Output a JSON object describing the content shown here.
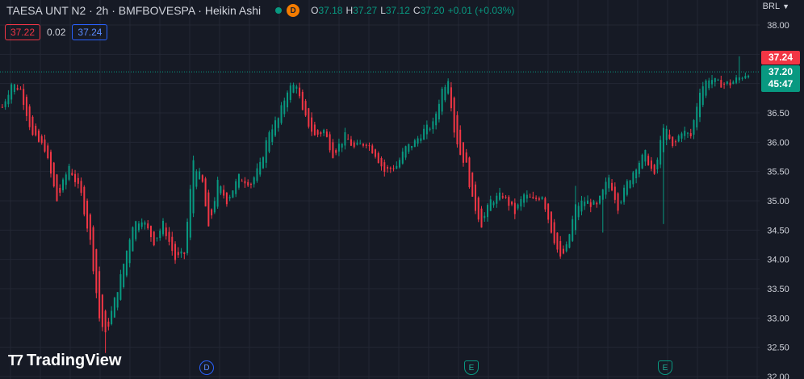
{
  "header": {
    "title": "TAESA UNT N2 · 2h · BMFBOVESPA · Heikin Ashi",
    "delay_badge": "D",
    "ohlc": [
      {
        "k": "O",
        "v": "37.18"
      },
      {
        "k": "H",
        "v": "37.27"
      },
      {
        "k": "L",
        "v": "37.12"
      },
      {
        "k": "C",
        "v": "37.20"
      },
      {
        "k": "",
        "v": "+0.01 (+0.03%)"
      }
    ]
  },
  "quote": {
    "bid": "37.22",
    "spread": "0.02",
    "ask": "37.24"
  },
  "currency": "BRL",
  "price_tags": {
    "ask": "37.24",
    "last": "37.20",
    "countdown": "45:47"
  },
  "branding": {
    "logo_text": "TradingView"
  },
  "events": [
    {
      "label": "D",
      "kind": "dividend"
    },
    {
      "label": "E",
      "kind": "earnings"
    },
    {
      "label": "E",
      "kind": "earnings"
    }
  ],
  "colors": {
    "background": "#161a25",
    "up": "#089981",
    "down": "#f23645",
    "grid": "#232734",
    "axis_text": "#d1d4dc"
  },
  "chart_data": {
    "type": "candlestick",
    "style": "heikin-ashi",
    "last_price": 37.2,
    "ylim": [
      32.0,
      38.0
    ],
    "y_ticks": [
      "38.00",
      "37.50",
      "37.00",
      "36.50",
      "36.00",
      "35.50",
      "35.00",
      "34.50",
      "34.00",
      "33.50",
      "33.00",
      "32.50",
      "32.00"
    ],
    "grid": true,
    "path": [
      [
        0,
        36.6
      ],
      [
        3,
        37.0
      ],
      [
        6,
        36.9
      ],
      [
        10,
        36.1
      ],
      [
        14,
        35.9
      ],
      [
        18,
        35.0
      ],
      [
        22,
        35.6
      ],
      [
        26,
        35.1
      ],
      [
        29,
        34.3
      ],
      [
        32,
        33.0
      ],
      [
        34,
        32.7
      ],
      [
        36,
        33.1
      ],
      [
        39,
        33.7
      ],
      [
        43,
        34.6
      ],
      [
        46,
        34.7
      ],
      [
        50,
        34.3
      ],
      [
        53,
        34.6
      ],
      [
        57,
        34.0
      ],
      [
        60,
        34.1
      ],
      [
        63,
        35.7
      ],
      [
        66,
        35.3
      ],
      [
        68,
        34.5
      ],
      [
        71,
        35.3
      ],
      [
        74,
        35.0
      ],
      [
        78,
        35.4
      ],
      [
        82,
        35.3
      ],
      [
        85,
        35.6
      ],
      [
        88,
        36.2
      ],
      [
        91,
        36.4
      ],
      [
        94,
        36.9
      ],
      [
        97,
        37.0
      ],
      [
        99,
        36.5
      ],
      [
        103,
        36.1
      ],
      [
        106,
        36.2
      ],
      [
        109,
        35.8
      ],
      [
        113,
        36.1
      ],
      [
        116,
        35.9
      ],
      [
        120,
        36.0
      ],
      [
        123,
        35.8
      ],
      [
        126,
        35.5
      ],
      [
        130,
        35.6
      ],
      [
        133,
        35.9
      ],
      [
        136,
        36.0
      ],
      [
        139,
        36.2
      ],
      [
        142,
        36.3
      ],
      [
        145,
        36.9
      ],
      [
        147,
        37.1
      ],
      [
        149,
        36.2
      ],
      [
        151,
        35.8
      ],
      [
        153,
        35.6
      ],
      [
        155,
        35.0
      ],
      [
        158,
        34.6
      ],
      [
        161,
        35.0
      ],
      [
        165,
        35.1
      ],
      [
        169,
        34.8
      ],
      [
        172,
        35.1
      ],
      [
        175,
        35.0
      ],
      [
        178,
        35.1
      ],
      [
        181,
        34.5
      ],
      [
        184,
        34.0
      ],
      [
        186,
        34.2
      ],
      [
        189,
        34.9
      ],
      [
        192,
        35.0
      ],
      [
        196,
        34.9
      ],
      [
        200,
        35.4
      ],
      [
        203,
        34.9
      ],
      [
        206,
        35.3
      ],
      [
        209,
        35.6
      ],
      [
        212,
        35.8
      ],
      [
        215,
        35.4
      ],
      [
        218,
        36.3
      ],
      [
        221,
        35.9
      ],
      [
        224,
        36.2
      ],
      [
        227,
        36.1
      ],
      [
        230,
        36.9
      ],
      [
        233,
        37.1
      ],
      [
        236,
        37.0
      ],
      [
        240,
        37.0
      ],
      [
        243,
        37.1
      ],
      [
        246,
        37.2
      ]
    ]
  }
}
